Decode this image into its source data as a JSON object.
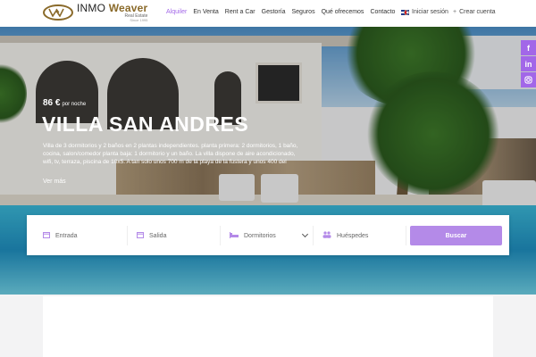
{
  "header": {
    "logo": {
      "name_part1": "INMO",
      "name_part2": "Weaver",
      "sub": "Real Estate",
      "since": "Since 1995"
    },
    "nav": [
      {
        "label": "Alquiler",
        "active": true
      },
      {
        "label": "En Venta"
      },
      {
        "label": "Rent a Car"
      },
      {
        "label": "Gestoría"
      },
      {
        "label": "Seguros"
      },
      {
        "label": "Qué ofrecemos"
      },
      {
        "label": "Contacto"
      }
    ],
    "language_icon": "uk-flag-icon",
    "account": {
      "login": "Iniciar sesión",
      "register": "Crear cuenta"
    }
  },
  "hero": {
    "price": "86 €",
    "price_unit": "por noche",
    "title": "VILLA SAN ANDRES",
    "description": "Villa de 3 dormitorios y 2 baños en 2 plantas independientes. planta primera: 2 dormitorios, 1 baño, cocina, salon/comedor planta baja: 1 dormitorio y un baño. La villa dispone de aire acondicionado, wifi, tv, terraza, piscina de 10x5. A tan solo unos 700 m de la playa de la fustera y unos 400 del",
    "more": "Ver más"
  },
  "social": [
    "facebook-icon",
    "linkedin-icon",
    "instagram-icon"
  ],
  "search": {
    "checkin_placeholder": "Entrada",
    "checkout_placeholder": "Salida",
    "bedrooms_label": "Dormitorios",
    "guests_placeholder": "Huéspedes",
    "submit": "Buscar"
  },
  "colors": {
    "accent": "#a267e8",
    "accent_light": "#b48ae8"
  }
}
